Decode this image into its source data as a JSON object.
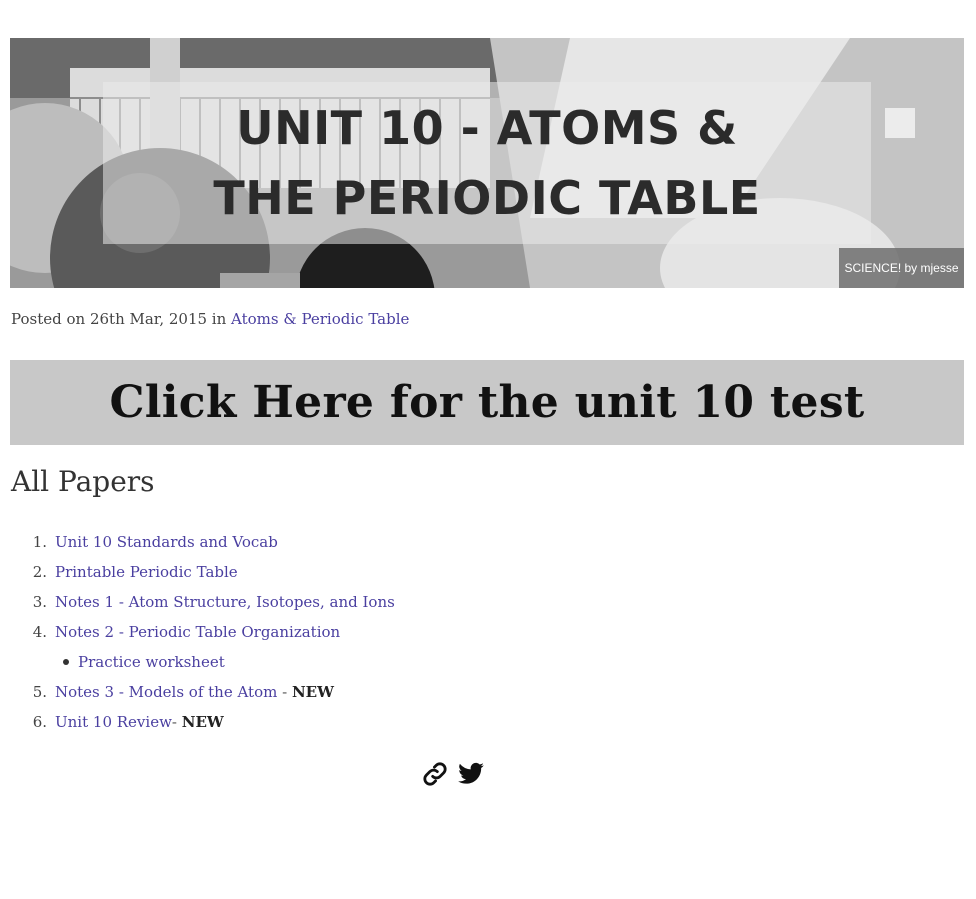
{
  "hero": {
    "title": "UNIT 10 - ATOMS & THE PERIODIC TABLE",
    "credit": "SCIENCE! by mjesse"
  },
  "meta": {
    "posted_prefix": "Posted on 26th Mar, 2015 in ",
    "category": "Atoms & Periodic Table"
  },
  "cta": {
    "label": "Click Here for the unit 10 test"
  },
  "papers": {
    "title": "All Papers",
    "items": [
      {
        "num": "1.",
        "label": "Unit 10 Standards and Vocab"
      },
      {
        "num": "2.",
        "label": "Printable Periodic Table"
      },
      {
        "num": "3.",
        "label": "Notes 1 - Atom Structure, Isotopes, and Ions"
      },
      {
        "num": "4.",
        "label": "Notes 2 - Periodic Table Organization"
      },
      {
        "num": "5.",
        "label": "Notes 3 - Models of the Atom",
        "sep": " - ",
        "badge": "NEW"
      },
      {
        "num": "6.",
        "label": "Unit 10 Review",
        "sep": "- ",
        "badge": "NEW"
      }
    ],
    "sub_item": {
      "label": "Practice worksheet"
    }
  },
  "share": {
    "icons": [
      "link-icon",
      "twitter-icon"
    ]
  }
}
